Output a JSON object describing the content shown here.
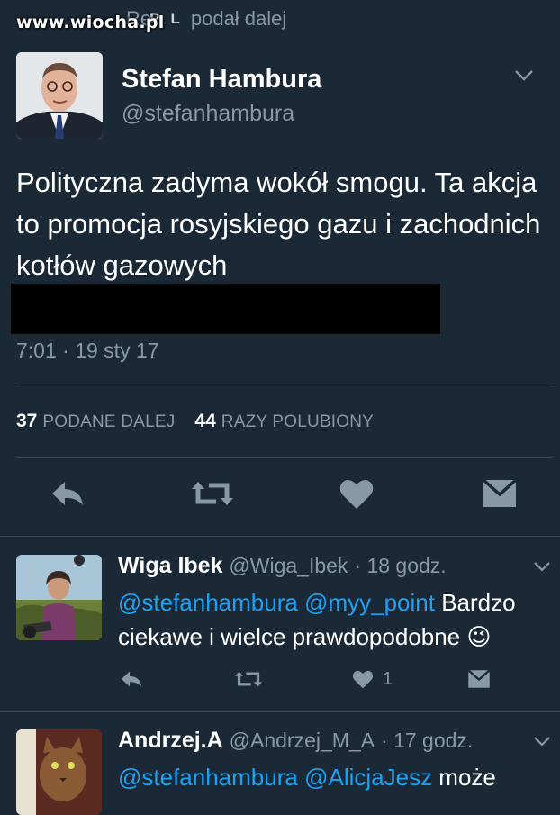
{
  "watermark": "www.wiocha.pl",
  "retweet_bar": {
    "prefix": "Re",
    "tag_p": "P",
    "tag_l": "L",
    "label": "podał dalej"
  },
  "tweet": {
    "name": "Stefan Hambura",
    "handle": "@stefanhambura",
    "text": "Polityczna zadyma wokół smogu. Ta akcja to promocja rosyjskiego gazu i zachodnich kotłów gazowych",
    "timestamp": "7:01 · 19 sty 17",
    "retweets_count": "37",
    "retweets_label": "PODANE DALEJ",
    "likes_count": "44",
    "likes_label": "RAZY POLUBIONY"
  },
  "replies": [
    {
      "name": "Wiga Ibek",
      "handle": "@Wiga_Ibek",
      "time": "· 18 godz.",
      "mention1": "@stefanhambura",
      "mention2": "@myy_point",
      "text": "Bardzo ciekawe i wielce prawdopodobne",
      "emoji": "😉",
      "likes": "1"
    },
    {
      "name": "Andrzej.A",
      "handle": "@Andrzej_M_A",
      "time": "· 17 godz.",
      "mention1": "@stefanhambura",
      "mention2": "@AlicjaJesz",
      "text": "może"
    }
  ],
  "icons": [
    "reply-icon",
    "retweet-icon",
    "heart-icon",
    "message-icon",
    "chevron-down-icon"
  ],
  "colors": {
    "background": "#1b2836",
    "accent": "#1da1f2",
    "muted": "#8899a6",
    "divider": "#38444d"
  }
}
